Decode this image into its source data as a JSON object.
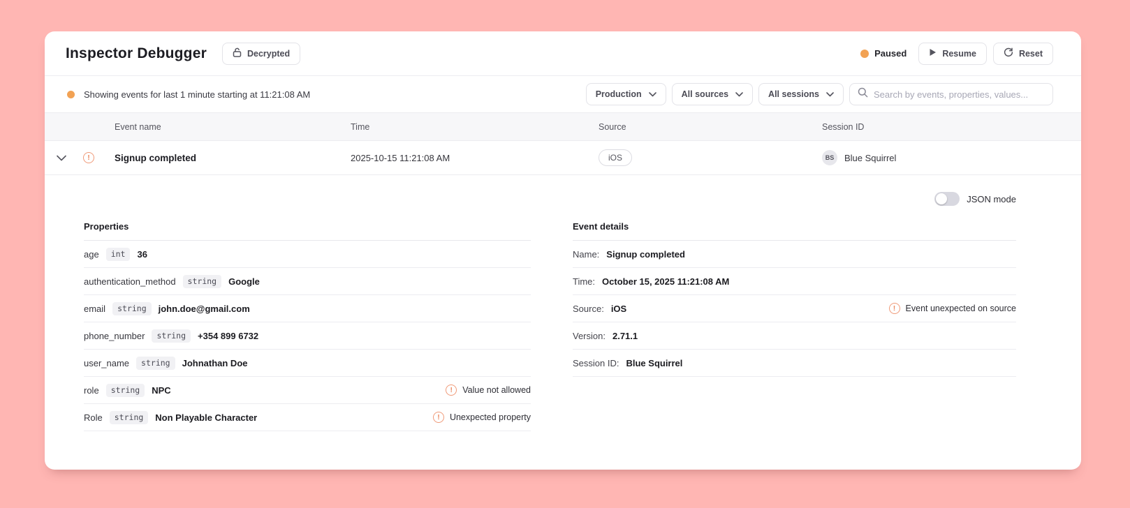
{
  "app": {
    "title": "Inspector Debugger",
    "decrypted_button": "Decrypted",
    "status_label": "Paused",
    "resume_button": "Resume",
    "reset_button": "Reset"
  },
  "filter_bar": {
    "status_text": "Showing events for last 1 minute starting at 11:21:08 AM",
    "dropdowns": [
      {
        "label": "Production"
      },
      {
        "label": "All sources"
      },
      {
        "label": "All sessions"
      }
    ],
    "search_placeholder": "Search by events, properties, values..."
  },
  "table": {
    "columns": [
      "Event name",
      "Time",
      "Source",
      "Session ID"
    ],
    "row": {
      "event_name": "Signup completed",
      "time": "2025-10-15 11:21:08 AM",
      "source": "iOS",
      "session_initials": "BS",
      "session_name": "Blue Squirrel"
    }
  },
  "details": {
    "json_mode_label": "JSON mode",
    "properties": {
      "heading": "Properties",
      "rows": [
        {
          "key": "age",
          "type": "int",
          "value": "36"
        },
        {
          "key": "authentication_method",
          "type": "string",
          "value": "Google"
        },
        {
          "key": "email",
          "type": "string",
          "value": "john.doe@gmail.com"
        },
        {
          "key": "phone_number",
          "type": "string",
          "value": "+354 899 6732"
        },
        {
          "key": "user_name",
          "type": "string",
          "value": "Johnathan Doe"
        },
        {
          "key": "role",
          "type": "string",
          "value": "NPC",
          "warning": "Value not allowed"
        },
        {
          "key": "Role",
          "type": "string",
          "value": "Non Playable Character",
          "warning": "Unexpected property"
        }
      ]
    },
    "event_details": {
      "heading": "Event details",
      "rows": [
        {
          "label": "Name:",
          "value": "Signup completed"
        },
        {
          "label": "Time:",
          "value": "October 15, 2025 11:21:08 AM"
        },
        {
          "label": "Source:",
          "value": "iOS",
          "warning": "Event unexpected on source"
        },
        {
          "label": "Version:",
          "value": "2.71.1"
        },
        {
          "label": "Session ID:",
          "value": "Blue Squirrel"
        }
      ]
    }
  },
  "colors": {
    "background": "#ffb6b3",
    "accent_orange": "#f2a254",
    "warning_orange": "#f09a78"
  }
}
